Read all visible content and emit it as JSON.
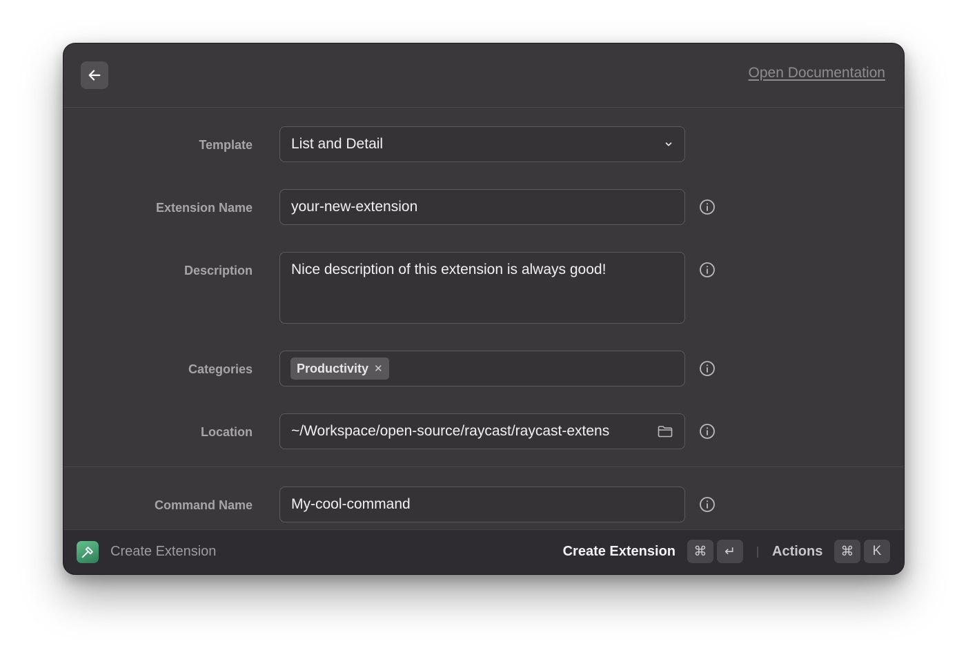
{
  "header": {
    "back_icon": "arrow-left-icon",
    "doc_link": "Open Documentation"
  },
  "form": {
    "template": {
      "label": "Template",
      "value": "List and Detail"
    },
    "extension_name": {
      "label": "Extension Name",
      "value": "your-new-extension"
    },
    "description": {
      "label": "Description",
      "value": "Nice description of this extension is always good!"
    },
    "categories": {
      "label": "Categories",
      "tags": [
        "Productivity"
      ]
    },
    "location": {
      "label": "Location",
      "value": "~/Workspace/open-source/raycast/raycast-extens"
    },
    "command_name": {
      "label": "Command Name",
      "value": "My-cool-command"
    }
  },
  "footer": {
    "title": "Create Extension",
    "primary_action": "Create Extension",
    "primary_keys": [
      "⌘",
      "↵"
    ],
    "actions_label": "Actions",
    "actions_keys": [
      "⌘",
      "K"
    ]
  },
  "colors": {
    "window_bg": "#3b383c",
    "footer_bg": "#2f2c31",
    "accent_icon": "#4fa877"
  }
}
